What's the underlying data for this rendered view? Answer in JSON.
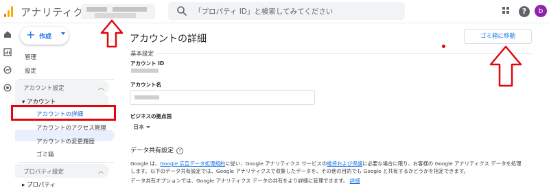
{
  "app": {
    "title": "アナリティクス"
  },
  "search": {
    "placeholder": "「プロパティ ID」と検索してみてください"
  },
  "header": {
    "avatar_letter": "b",
    "help_glyph": "?"
  },
  "sidebar": {
    "create_label": "作成",
    "items": [
      {
        "label": "管理"
      },
      {
        "label": "設定"
      }
    ],
    "account_section": {
      "label": "アカウント設定",
      "account_toggle": "アカウント",
      "sub_items": [
        {
          "label": "アカウントの詳細",
          "active": true
        },
        {
          "label": "アカウントのアクセス管理"
        },
        {
          "label": "アカウントの変更履歴"
        },
        {
          "label": "ゴミ箱"
        }
      ]
    },
    "property_section": {
      "label": "プロパティ設定",
      "property_toggle": "プロパティ"
    }
  },
  "main": {
    "page_title": "アカウントの詳細",
    "trash_button": "ゴミ箱に移動",
    "basic_settings": "基本設定",
    "account_id_label": "アカウント ID",
    "account_name_label": "アカウント名",
    "business_country_label": "ビジネスの拠点国",
    "business_country_value": "日本",
    "data_sharing_heading": "データ共有設定",
    "para1_prefix": "Google は、",
    "para1_link1": "Google 広告データ処理規約",
    "para1_mid": "に従い、Google アナリティクス サービスの",
    "para1_link2": "維持および保護",
    "para1_rest": "に必要な場合に限り、お客様の Google アナリティクス データを処理",
    "para1_line2": "します。以下のデータ共有設定では、Google アナリティクスで収集したデータを、その他の目的でも Google と共有するかどうかを指定できます。",
    "para2_text": "データ共有オプションでは、Google アナリティクス データの共有をより詳細に管理できます。",
    "para2_link": "詳細"
  },
  "colors": {
    "accent": "#1a73e8",
    "annotation_red": "#e0060c",
    "avatar": "#8e24aa",
    "logo_orange": "#f9ab00",
    "logo_dark": "#e37400"
  }
}
